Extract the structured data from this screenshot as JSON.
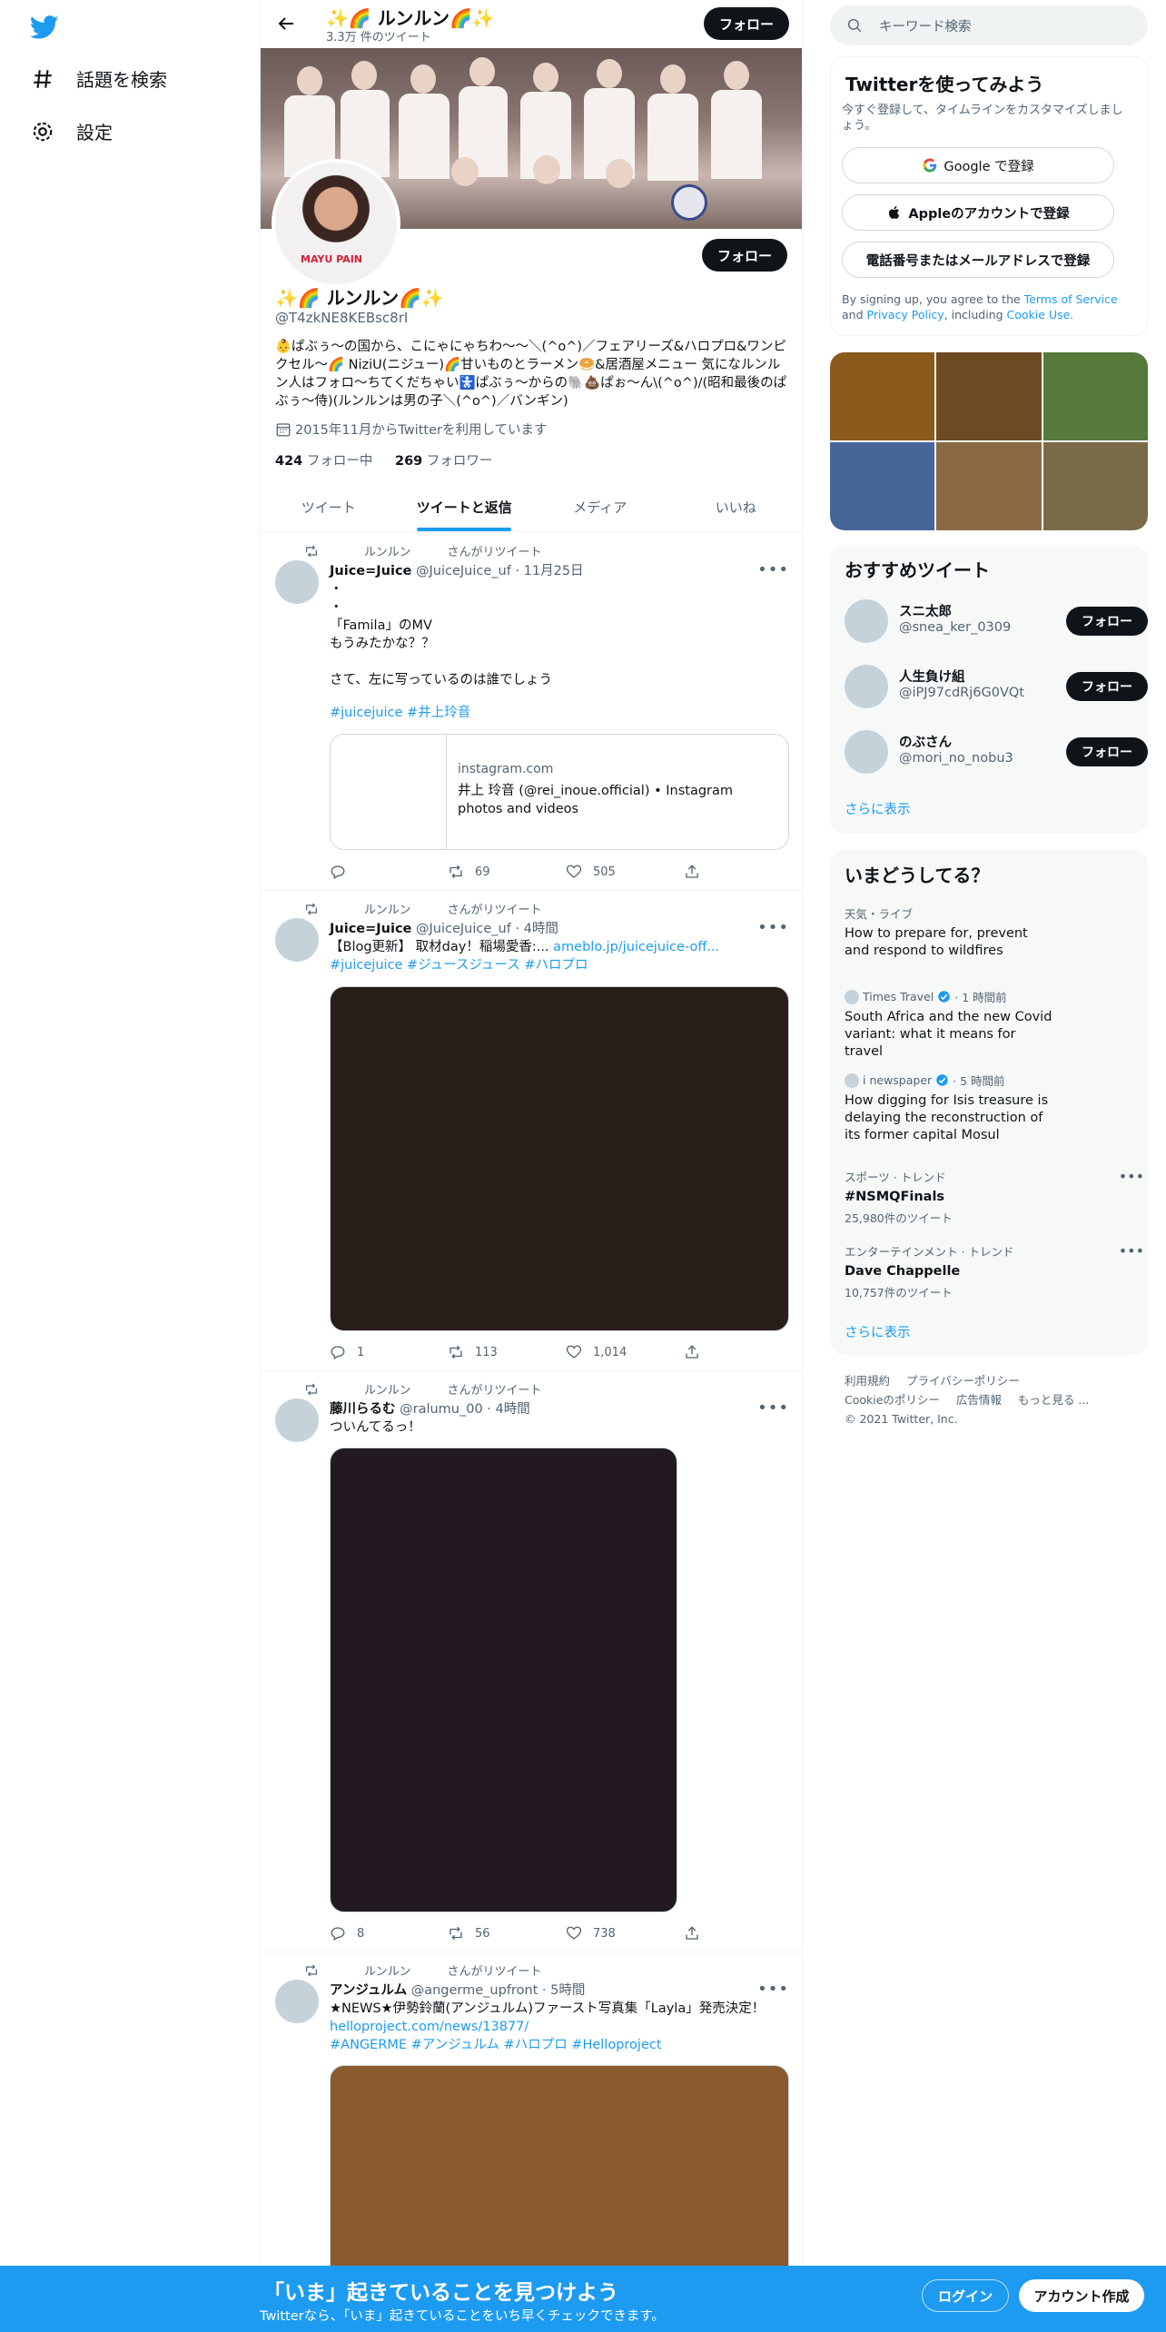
{
  "nav": {
    "explore_label": "話題を検索",
    "settings_label": "設定"
  },
  "header": {
    "name": "✨🌈 ルンルン🌈✨",
    "tweet_count": "3.3万 件のツイート",
    "follow_label": "フォロー"
  },
  "profile": {
    "avatar_text": "MAYU PAIN",
    "name": "✨🌈 ルンルン🌈✨",
    "handle": "@T4zkNE8KEBsc8rI",
    "bio": "👶ぱぶぅ〜の国から、こにゃにゃちわ〜〜＼(^o^)／フェアリーズ&ハロプロ&ワンピクセル〜🌈 NiziU(ニジュー)🌈甘いものとラーメン🥯&居酒屋メニュー 気になルンルン人はフォロ〜ちてくだちゃい🚼ぱぶぅ〜からの🐘💩ぱぉ〜ん\\(^o^)/(昭和最後のぱぶぅ〜侍)(ルンルンは男の子＼(^o^)／バンギン)",
    "joined": "2015年11月からTwitterを利用しています",
    "following_count": "424",
    "following_label": "フォロー中",
    "followers_count": "269",
    "followers_label": "フォロワー",
    "follow_label": "フォロー"
  },
  "tabs": [
    "ツイート",
    "ツイートと返信",
    "メディア",
    "いいね"
  ],
  "tweets": [
    {
      "retweeter": "ルンルン",
      "rt_suffix": "さんがリツイート",
      "name": "Juice=Juice",
      "meta": "@JuiceJuice_uf · 11月25日",
      "text": "・\n・\n「Famila」のMV\nもうみたかな？？\n\nさて、左に写っているのは誰でしょう",
      "hashtags": "#juicejuice #井上玲音",
      "card_domain": "instagram.com",
      "card_title": "井上 玲音 (@rei_inoue.official) • Instagram photos and videos",
      "reply": "",
      "retweets": "69",
      "likes": "505"
    },
    {
      "retweeter": "ルンルン",
      "rt_suffix": "さんがリツイート",
      "name": "Juice=Juice",
      "meta": "@JuiceJuice_uf · 4時間",
      "text": "【Blog更新】 取材day！稲場愛香:...",
      "link": "ameblo.jp/juicejuice-off...",
      "hashtags": "#juicejuice #ジュースジュース #ハロプロ",
      "reply": "1",
      "retweets": "113",
      "likes": "1,014"
    },
    {
      "retweeter": "ルンルン",
      "rt_suffix": "さんがリツイート",
      "name": "藤川らるむ",
      "meta": "@ralumu_00 · 4時間",
      "text": "ついんてるっ！",
      "reply": "8",
      "retweets": "56",
      "likes": "738"
    },
    {
      "retweeter": "ルンルン",
      "rt_suffix": "さんがリツイート",
      "name": "アンジュルム",
      "meta": "@angerme_upfront · 5時間",
      "text": "★NEWS★伊勢鈴蘭(アンジュルム)ファースト写真集「Layla」発売決定！",
      "link": "helloproject.com/news/13877/",
      "hashtags": "#ANGERME #アンジュルム #ハロプロ #Helloproject"
    }
  ],
  "right": {
    "search_placeholder": "キーワード検索",
    "signup_title": "Twitterを使ってみよう",
    "signup_sub": "今すぐ登録して、タイムラインをカスタマイズしましょう。",
    "google_label": "Google で登録",
    "apple_label": "Appleのアカウントで登録",
    "phone_label": "電話番号またはメールアドレスで登録",
    "terms_prefix": "By signing up, you agree to the ",
    "terms_tos": "Terms of Service",
    "terms_and": " and ",
    "terms_privacy": "Privacy Policy",
    "terms_including": ", including ",
    "terms_cookie": "Cookie Use.",
    "wtf_title": "おすすめツイート",
    "wtf": [
      {
        "name": "スニ太郎",
        "handle": "@snea_ker_0309",
        "follow": "フォロー"
      },
      {
        "name": "人生負け組",
        "handle": "@iPJ97cdRj6G0VQt",
        "follow": "フォロー"
      },
      {
        "name": "のぶさん",
        "handle": "@mori_no_nobu3",
        "follow": "フォロー"
      }
    ],
    "show_more": "さらに表示",
    "trends_title": "いまどうしてる？",
    "trends": [
      {
        "cat": "天気・ライブ",
        "title": "How to prepare for, prevent and respond to wildfires"
      },
      {
        "source": "Times Travel",
        "time": "· 1 時間前",
        "title": "South Africa and the new Covid variant: what it means for travel"
      },
      {
        "source": "i newspaper",
        "time": "· 5 時間前",
        "title": "How digging for Isis treasure is delaying the reconstruction of its former capital Mosul"
      },
      {
        "cat": "スポーツ · トレンド",
        "title": "#NSMQFinals",
        "count": "25,980件のツイート"
      },
      {
        "cat": "エンターテインメント · トレンド",
        "title": "Dave Chappelle",
        "count": "10,757件のツイート"
      }
    ],
    "trends_more": "さらに表示",
    "footer": {
      "terms": "利用規約",
      "privacy": "プライバシーポリシー",
      "cookie": "Cookieのポリシー",
      "ads": "広告情報",
      "more": "もっと見る ...",
      "copyright": "© 2021 Twitter, Inc."
    }
  },
  "bottom": {
    "title": "「いま」起きていることを見つけよう",
    "sub": "Twitterなら、「いま」起きていることをいち早くチェックできます。",
    "login": "ログイン",
    "signup": "アカウント作成"
  },
  "colors": {
    "accent": "#1d9bf0",
    "dark_button": "#0f1419",
    "photo_grid": [
      "#8b5a1c",
      "#6e4a22",
      "#557a3a",
      "#46669a",
      "#8a6a44",
      "#7a6a48"
    ],
    "media_2": "#2a1e1a",
    "media_3": "#221a20",
    "media_4": "#8a5a30"
  }
}
